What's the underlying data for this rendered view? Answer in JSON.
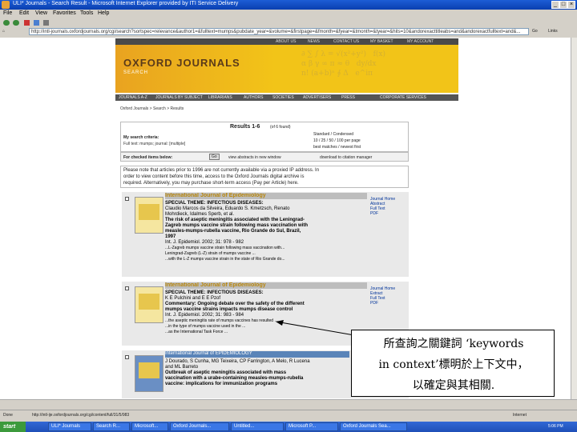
{
  "window": {
    "title": "ULI* Journals - Search Result - Microsoft Internet Explorer provided by ITI Service Delivery",
    "menu": [
      "File",
      "Edit",
      "View",
      "Favorites",
      "Tools",
      "Help"
    ],
    "address": "http://intl-journals.oxfordjournals.org/cgi/search?sortspec=relevance&author1=&fulltext=mumps&pubdate_year=&volume=&firstpage=&fmonth=&fyear=&tmonth=&tyear=&hits=10&andorexacttitleabs=and&andorexactfulltext=and&...",
    "go_label": "Go",
    "links_label": "Links"
  },
  "site": {
    "nav": [
      "ABOUT US",
      "NEWS",
      "CONTACT US",
      "MY BASKET",
      "MY ACCOUNT"
    ],
    "banner_title": "OXFORD JOURNALS",
    "banner_sub": "SEARCH",
    "subnav": [
      "JOURNALS A-Z",
      "JOURNALS BY SUBJECT",
      "LIBRARIANS",
      "AUTHORS",
      "SOCIETIES",
      "ADVERTISERS",
      "PRESS",
      "CORPORATE SERVICES"
    ],
    "breadcrumb": "Oxford Journals > Search > Results"
  },
  "results": {
    "count_label": "Results 1-6",
    "count_note": "(of 6 found)",
    "criteria_label": "My search criteria:",
    "criteria_value": "Full text: mumps; journal: [multiple]",
    "format_label": "Standard / Condensed",
    "per_page": "10 / 25 / 50 / 100 per page",
    "sort_label": "best matches / newest first",
    "checked_label": "For checked items below:",
    "go_btn": "Go",
    "view_abstracts": "view abstracts in new window",
    "download_citation": "download to citation manager",
    "notice": [
      "Please note that articles prior to 1996 are not currently available via a proxied IP address. In",
      "order to view content before this time, access to the Oxford Journals digital archive is",
      "required. Alternatively, you may purchase short-term access (Pay per Article) here."
    ],
    "articles": [
      {
        "journal": "International Journal of Epidemiology",
        "lines": [
          "SPECIAL THEME: INFECTIOUS DISEASES:",
          "Claudio Marcos da Silveira, Eduardo S. Kmetzsch, Renato",
          "Mohrdieck, Idalmes Sperb, et al.",
          "The risk of aseptic meningitis associated with the Leningrad-",
          "Zagreb mumps vaccine strain following mass vaccination with",
          "measles-mumps-rubella vaccine, Rio Grande do Sul, Brazil,",
          "1997",
          "Int. J. Epidemiol. 2002; 31: 978 - 982",
          "...L-Zagreb mumps vaccine strain following mass vaccination with...",
          "Leningrad-Zagreb (L-Z) strain of mumps vaccine ...",
          "...with the L-Z mumps vaccine strain in the state of Rio Grande do..."
        ],
        "links": [
          "Journal Home",
          "Abstract",
          "Full Text",
          "PDF"
        ]
      },
      {
        "journal": "International Journal of Epidemiology",
        "lines": [
          "SPECIAL THEME: INFECTIOUS DISEASES:",
          "K E Pulchini and E E Pzof",
          "Commentary: Ongoing debate over the safety of the different",
          "mumps vaccine strains impacts mumps disease control",
          "Int. J. Epidemiol. 2002; 31: 983 - 984",
          "...the aseptic meningitis rate of mumps vaccines has resulted ...",
          "...in the type of mumps vaccine used in the ...",
          "...as the International Task Force ..."
        ],
        "links": [
          "Journal Home",
          "Extract",
          "Full Text",
          "PDF"
        ]
      },
      {
        "journal": "International Journal of EPIDEMIOLOGY",
        "lines": [
          "J Dourado, S Cunha, MG Teixeira, CP Farrington, A Melo, R Lucena",
          "and ML Barreto",
          "Outbreak of aseptic meningitis associated with mass",
          "vaccination with a urabe-containing measles-mumps-rubella",
          "vaccine: implications for immunization programs"
        ],
        "links": []
      }
    ]
  },
  "annotation": {
    "line1": "所查詢之關鍵詞 ‘keywords",
    "line2": "in context’標明於上下文中，",
    "line3": "以確定與其相關."
  },
  "status": {
    "left": "Done",
    "url": "http://intl-ije.oxfordjournals.org/cgi/content/full/31/5/983",
    "zone": "Internet"
  },
  "taskbar": {
    "start": "start",
    "items": [
      "ULI* Journals",
      "Search R...",
      "Microsoft...",
      "Oxford Journals...",
      "Untitled...",
      "Microsoft P...",
      "Oxford Journals Sea..."
    ],
    "clock": "5:06 PM"
  }
}
